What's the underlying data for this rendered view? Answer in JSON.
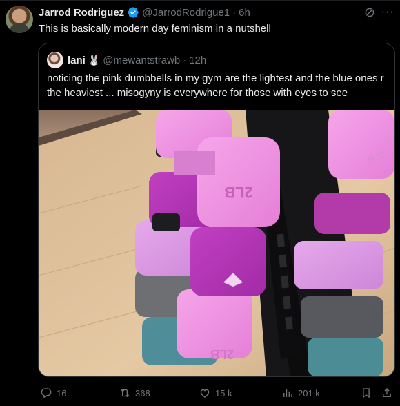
{
  "tweet": {
    "author_name": "Jarrod Rodriguez",
    "author_handle": "@JarrodRodrigue1",
    "separator": "·",
    "time": "6h",
    "text": "This is basically modern day feminism in a nutshell",
    "verified_color": "#1d9bf0"
  },
  "quote": {
    "author_name": "lani",
    "emoji": "🐰",
    "author_handle": "@mewantstrawb",
    "separator": "·",
    "time": "12h",
    "text": "noticing the pink dumbbells in my gym are the lightest and the blue ones r the heaviest ... misogyny is everywhere for those with eyes to see",
    "media_alt": "photo of pink, purple, grey and blue dumbbells on a black rack",
    "dumbbell_label": "2LB"
  },
  "actions": {
    "replies": "16",
    "retweets": "368",
    "likes": "15 k",
    "views": "201 k"
  },
  "icons": {
    "verified": "verified-badge-icon",
    "grok": "grok-icon",
    "more": "more-icon",
    "reply": "reply-icon",
    "retweet": "retweet-icon",
    "like": "like-icon",
    "views": "views-icon",
    "bookmark": "bookmark-icon",
    "share": "share-icon"
  },
  "colors": {
    "background": "#000000",
    "text": "#e7e9ea",
    "muted": "#71767b",
    "border": "#2f3336",
    "accent": "#1d9bf0"
  }
}
